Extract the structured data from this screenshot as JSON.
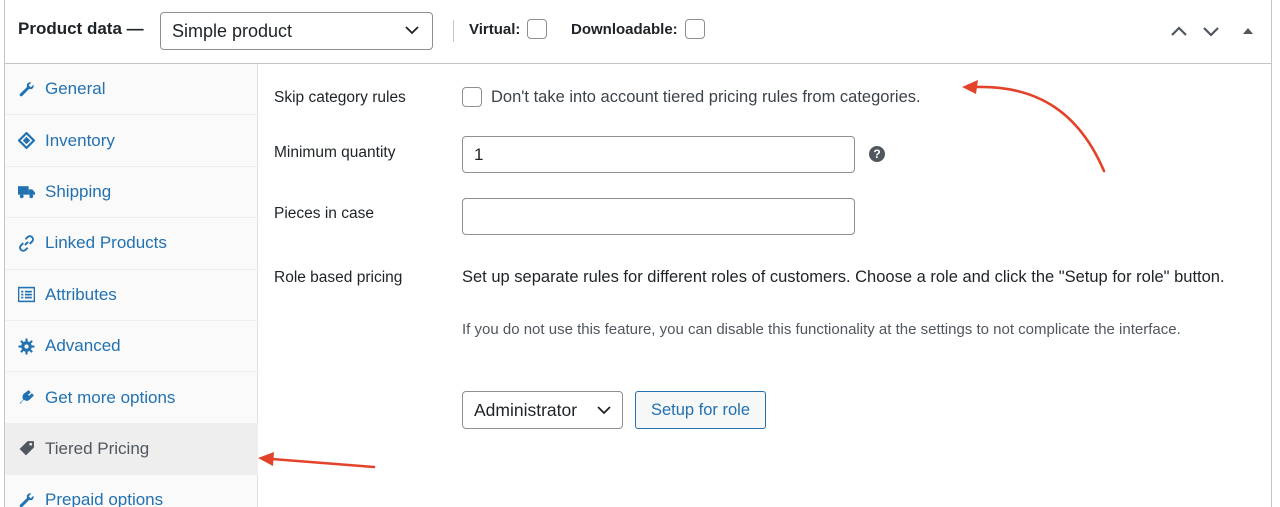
{
  "header": {
    "title": "Product data —",
    "product_type": "Simple product",
    "virtual_label": "Virtual:",
    "downloadable_label": "Downloadable:"
  },
  "sidebar": {
    "items": [
      {
        "label": "General",
        "icon": "wrench-icon"
      },
      {
        "label": "Inventory",
        "icon": "tag-icon"
      },
      {
        "label": "Shipping",
        "icon": "truck-icon"
      },
      {
        "label": "Linked Products",
        "icon": "link-icon"
      },
      {
        "label": "Attributes",
        "icon": "list-icon"
      },
      {
        "label": "Advanced",
        "icon": "gear-icon"
      },
      {
        "label": "Get more options",
        "icon": "plugin-icon"
      },
      {
        "label": "Tiered Pricing",
        "icon": "price-tag-icon",
        "active": true
      },
      {
        "label": "Prepaid options",
        "icon": "wrench-icon"
      }
    ]
  },
  "main": {
    "skip_category": {
      "label": "Skip category rules",
      "description": "Don't take into account tiered pricing rules from categories."
    },
    "minimum_quantity": {
      "label": "Minimum quantity",
      "value": "1"
    },
    "pieces_in_case": {
      "label": "Pieces in case",
      "value": ""
    },
    "role_pricing": {
      "label": "Role based pricing",
      "description": "Set up separate rules for different roles of customers. Choose a role and click the \"Setup for role\" button.",
      "note": "If you do not use this feature, you can disable this functionality at the settings to not complicate the interface.",
      "selected_role": "Administrator",
      "setup_button": "Setup for role"
    }
  },
  "colors": {
    "link": "#2271b1",
    "annotation_arrow": "#e2432a",
    "border": "#c3c4c7"
  }
}
